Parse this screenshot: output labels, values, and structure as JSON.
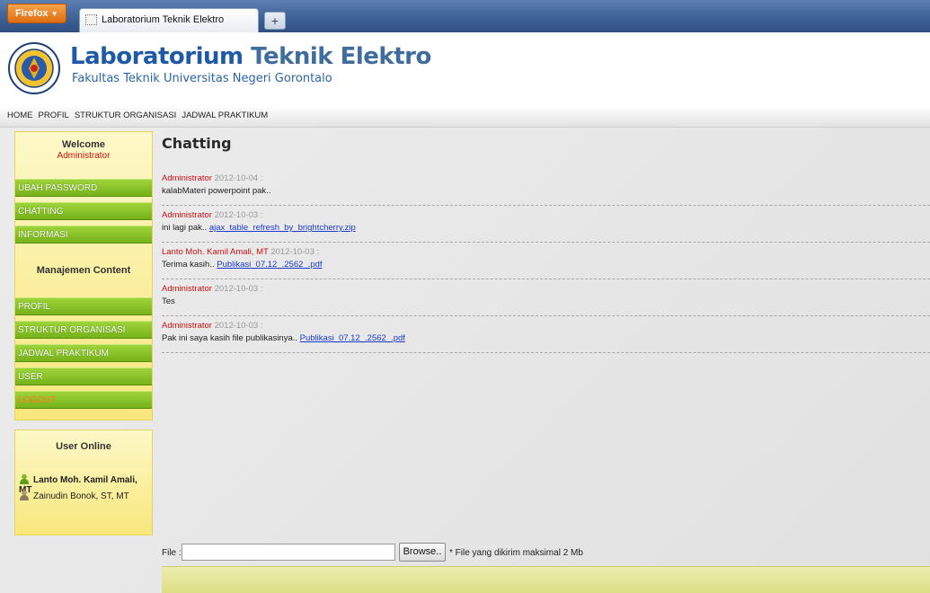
{
  "browser": {
    "menu_label": "Firefox",
    "tab_title": "Laboratorium Teknik Elektro",
    "new_tab_symbol": "+"
  },
  "header": {
    "title_part1": "Laboratorium",
    "title_part2": "Teknik Elektro",
    "subtitle": "Fakultas Teknik Universitas Negeri Gorontalo"
  },
  "topnav": [
    "HOME",
    "PROFIL",
    "STRUKTUR ORGANISASI",
    "JADWAL PRAKTIKUM"
  ],
  "sidebar": {
    "welcome_title": "Welcome",
    "welcome_user": "Administrator",
    "menu": [
      "UBAH PASSWORD",
      "CHATTING",
      "INFORMASI"
    ],
    "content_title": "Manajemen Content",
    "content_menu": [
      "PROFIL",
      "STRUKTUR ORGANISASI",
      "JADWAL PRAKTIKUM",
      "USER",
      "LOGOUT"
    ],
    "online_title": "User Online",
    "online_users": [
      "Lanto Moh. Kamil Amali, MT",
      "Zainudin Bonok, ST, MT"
    ]
  },
  "main": {
    "title": "Chatting",
    "messages": [
      {
        "author": "Administrator",
        "date": "2012-10-04 :",
        "text": "kalabMateri powerpoint pak..",
        "link": ""
      },
      {
        "author": "Administrator",
        "date": "2012-10-03 :",
        "text": "ini lagi pak.. ",
        "link": "ajax_table_refresh_by_brightcherry.zip"
      },
      {
        "author": "Lanto Moh. Kamil Amali, MT",
        "date": "2012-10-03 :",
        "text": "Terima kasih.. ",
        "link": "Publikasi_07.12_.2562_.pdf"
      },
      {
        "author": "Administrator",
        "date": "2012-10-03 :",
        "text": "Tes",
        "link": ""
      },
      {
        "author": "Administrator",
        "date": "2012-10-03 :",
        "text": "Pak ini saya kasih file publikasinya.. ",
        "link": "Publikasi_07.12_.2562_.pdf"
      }
    ],
    "file_label": "File :",
    "file_value": "",
    "browse_label": "Browse..",
    "file_note": "* File yang dikirim maksimal 2 Mb"
  },
  "colors": {
    "accent_green": "#8cc63f",
    "panel_yellow": "#f8e77c",
    "title_blue": "#1e5aa8",
    "author_red": "#cc1111"
  }
}
